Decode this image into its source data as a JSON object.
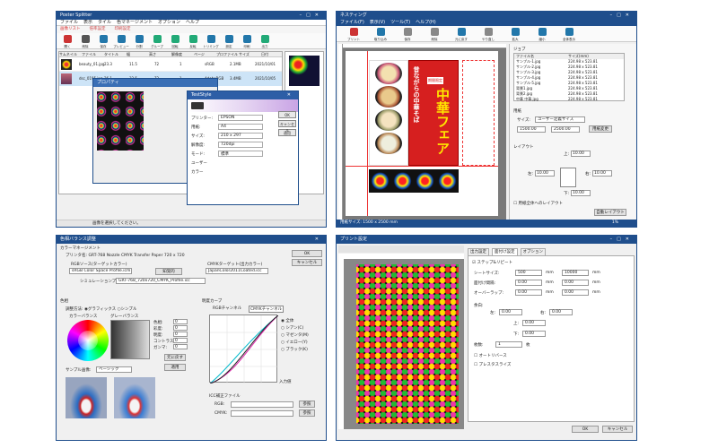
{
  "w1": {
    "title": "Poster Splitter",
    "menu": [
      "ファイル",
      "表示",
      "タイル",
      "色マネージメント",
      "オプション",
      "ヘルプ"
    ],
    "tabs": [
      "画像リスト",
      "倍率設定",
      "印刷設定"
    ],
    "tools": [
      "開く",
      "削除",
      "保存",
      "プレビュー",
      "分割",
      "グループ",
      "回転",
      "反転",
      "トリミング",
      "設定",
      "印刷",
      "出力"
    ],
    "cols": [
      "サムネイル",
      "ファイル",
      "タイトル",
      "幅",
      "高さ",
      "解像度",
      "ページ",
      "プロファイル",
      "サイズ",
      "日付"
    ],
    "rows": [
      [
        "beauty_01.jpg",
        "23.3",
        "11.5",
        "72",
        "1",
        "sRGB",
        "2.1MB",
        "2021/10/01"
      ],
      [
        "dsc_0195.jpg",
        "26.1",
        "32.5",
        "72",
        "1",
        "AdobeRGB",
        "3.4MB",
        "2021/10/05"
      ]
    ],
    "status": "画像を選択してください。",
    "dlg_back": "プロパティ",
    "dlg_front": {
      "title": "TestStyle",
      "fields": [
        "プリンター:",
        "用紙:",
        "サイズ:",
        "解像度:",
        "モード:",
        "ユーザー",
        "カラー"
      ],
      "vals": [
        "EPSON",
        "A4",
        "210 x 297",
        "720dpi",
        "標準"
      ],
      "buttons": [
        "OK",
        "キャンセル",
        "適用"
      ]
    }
  },
  "w2": {
    "title": "ネスティング",
    "menu": [
      "ファイル(F)",
      "表示(V)",
      "ツール(T)",
      "ヘルプ(H)"
    ],
    "tools": [
      "プリント",
      "取り込み",
      "保存",
      "削除",
      "元に戻す",
      "やり直し",
      "拡大",
      "縮小",
      "全体表示"
    ],
    "poster_top": "昔ながらの中華そば",
    "poster_main": "中華フェア",
    "poster_sub": "期間限定",
    "list_title": "ジョブ",
    "list_header": [
      "ファイル名",
      "サイズ(mm)"
    ],
    "list": [
      [
        "サンプル-1.jpg",
        "224.98 x 523.81"
      ],
      [
        "サンプル-2.jpg",
        "224.98 x 523.81"
      ],
      [
        "サンプル-3.jpg",
        "224.98 x 523.81"
      ],
      [
        "サンプル-4.jpg",
        "224.98 x 523.81"
      ],
      [
        "サンプル-5.jpg",
        "224.98 x 523.81"
      ],
      [
        "背景1.jpg",
        "224.98 x 523.81"
      ],
      [
        "背景2.jpg",
        "224.98 x 523.81"
      ],
      [
        "中華 中華.jpg",
        "224.98 x 523.81"
      ]
    ],
    "paper": "用紙",
    "size_lbl": "サイズ:",
    "size_val": "ユーザー定義サイズ",
    "width_val": "1500.00",
    "height_val": "2500.00",
    "btn_change": "用紙変更",
    "layout": "レイアウト",
    "margin_vals": [
      "10.00",
      "10.00",
      "10.00",
      "10.00"
    ],
    "check_label": "用紙全体へのレイアウト",
    "btn_auto": "自動レイアウト",
    "status_left": "用紙サイズ: 1500 x 2500 mm",
    "status_right": "1%"
  },
  "w3": {
    "title": "色相バランス調整",
    "sec1": "カラーマネージメント",
    "printer": "プリンタ名: GRT-768 Nozzle CMYK Transfer Paper 720 x 720",
    "src_lbl": "RGBソース(ターゲットカラー)",
    "src_val": "sRGB Color Space Profile.icm",
    "arrow": "知覚的",
    "dst_lbl": "CMYKターゲット(出力カラー)",
    "dst_val": "JapanColor2011Coated.icc",
    "sim_lbl": "シミュレーションプロファイル",
    "sim_val": "GRT-768_720x720_CMYK_Profile.icc",
    "btn_ok": "OK",
    "btn_cancel": "キャンセル",
    "sec2": "色相",
    "mode": "調整方法:",
    "mode_a": "グラフィックス",
    "mode_b": "シンプル",
    "wheel_lbl": "カラーバランス",
    "gray_lbl": "グレーバランス",
    "fields": [
      "色相:",
      "彩度:",
      "明度:",
      "コントラスト:",
      "ガンマ:"
    ],
    "vals": [
      "0",
      "0",
      "0",
      "0",
      "0"
    ],
    "btn_reset": "元に戻す",
    "btn_apply": "適用",
    "sample_lbl": "サンプル画像:",
    "sample_val": "ベーシック",
    "sec3": "明度カーブ",
    "tab_rgb": "RGBチャンネル",
    "tab_cmyk": "CMYKチャンネル",
    "channels": [
      "全体",
      "シアン(C)",
      "マゼンタ(M)",
      "イエロー(Y)",
      "ブラック(K)"
    ],
    "x_lbl": "入力値",
    "file_lbl": "ICC補正ファイル",
    "rgb_lbl": "RGB:",
    "cmyk_lbl": "CMYK:",
    "btn_ref": "参照",
    "btn_ref2": "参照"
  },
  "w4": {
    "title": "プリント設定",
    "tabs": [
      "出力設定",
      "面付け設定",
      "オプション"
    ],
    "check_step": "ステップ&リピート",
    "rows": [
      {
        "l": "シートサイズ:",
        "a": "500",
        "u1": "mm",
        "b": "10000",
        "u2": "mm"
      },
      {
        "l": "面付け間隔:",
        "a": "0.00",
        "u1": "mm",
        "b": "0.00",
        "u2": "mm"
      },
      {
        "l": "オーバーラップ:",
        "a": "0.00",
        "u1": "mm",
        "b": "0.00",
        "u2": "mm"
      }
    ],
    "margin_lbl": "余白:",
    "m_left": "左:",
    "m_right": "右:",
    "m_top": "上:",
    "m_bottom": "下:",
    "mvals": [
      "0.00",
      "0.00",
      "0.00",
      "0.00"
    ],
    "copies_lbl": "枚数:",
    "copies": "1",
    "copies_u": "枚",
    "opt1": "オートリバース",
    "opt2": "プレスタスライズ",
    "btn_ok": "OK",
    "btn_cancel": "キャンセル"
  }
}
